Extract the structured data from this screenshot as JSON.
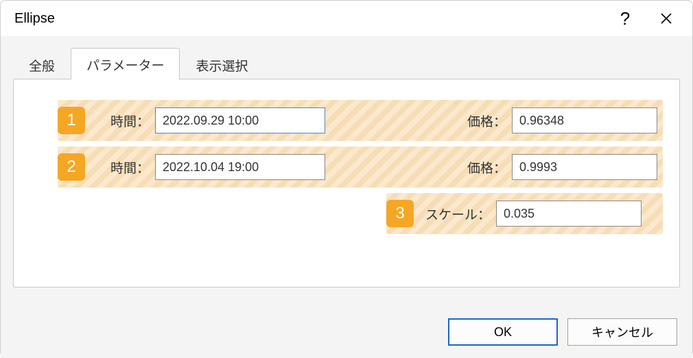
{
  "window": {
    "title": "Ellipse"
  },
  "tabs": {
    "general": "全般",
    "parameters": "パラメーター",
    "display": "表示選択"
  },
  "rows": {
    "r1": {
      "num": "1",
      "time_label": "時間：",
      "time_value": "2022.09.29 10:00",
      "price_label": "価格：",
      "price_value": "0.96348"
    },
    "r2": {
      "num": "2",
      "time_label": "時間：",
      "time_value": "2022.10.04 19:00",
      "price_label": "価格：",
      "price_value": "0.9993"
    },
    "r3": {
      "num": "3",
      "scale_label": "スケール：",
      "scale_value": "0.035"
    }
  },
  "buttons": {
    "ok": "OK",
    "cancel": "キャンセル"
  }
}
